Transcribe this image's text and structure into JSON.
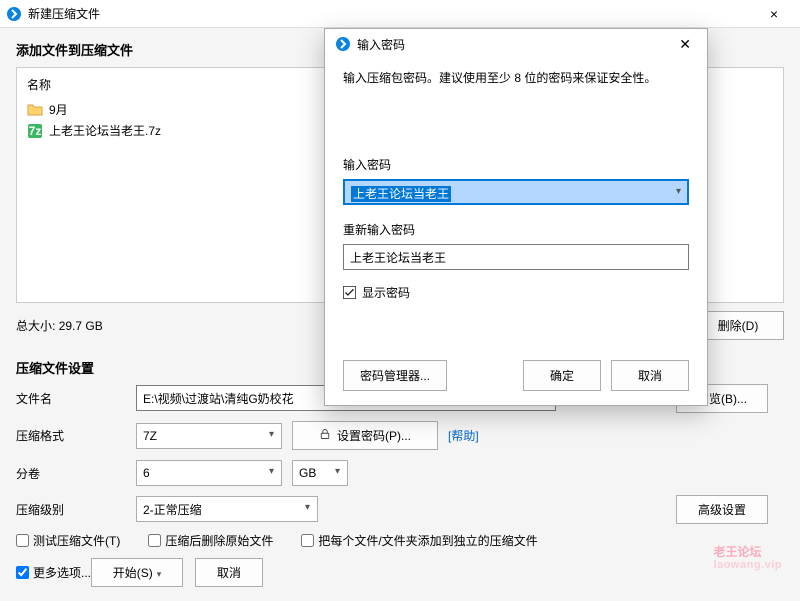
{
  "window": {
    "title": "新建压缩文件"
  },
  "add_section": {
    "title": "添加文件到压缩文件",
    "name_col": "名称",
    "items": [
      {
        "name": "9月",
        "type": "folder"
      },
      {
        "name": "上老王论坛当老王.7z",
        "type": "7z"
      }
    ],
    "total_label": "总大小:",
    "total_value": "29.7 GB",
    "delete_btn": "删除(D)"
  },
  "settings": {
    "title": "压缩文件设置",
    "filename_label": "文件名",
    "filename_value": "E:\\视频\\过渡站\\清纯G奶校花",
    "browse_btn": "浏览(B)...",
    "format_label": "压缩格式",
    "format_value": "7Z",
    "set_pwd_btn": "设置密码(P)...",
    "help_link": "[帮助]",
    "split_label": "分卷",
    "split_value": "6",
    "split_unit": "GB",
    "level_label": "压缩级别",
    "level_value": "2-正常压缩",
    "adv_btn": "高级设置",
    "test_chk": "测试压缩文件(T)",
    "delete_after_chk": "压缩后删除原始文件",
    "separate_chk": "把每个文件/文件夹添加到独立的压缩文件",
    "more_chk": "更多选项..."
  },
  "footer": {
    "start_btn": "开始(S)",
    "cancel_btn": "取消"
  },
  "modal": {
    "title": "输入密码",
    "hint": "输入压缩包密码。建议使用至少 8 位的密码来保证安全性。",
    "input_label": "输入密码",
    "password_value": "上老王论坛当老王",
    "reinput_label": "重新输入密码",
    "repassword_value": "上老王论坛当老王",
    "show_pwd": "显示密码",
    "show_pwd_checked": true,
    "manager_btn": "密码管理器...",
    "ok_btn": "确定",
    "cancel_btn": "取消"
  },
  "watermark": {
    "main": "老王论坛",
    "sub": "laowang.vip"
  }
}
